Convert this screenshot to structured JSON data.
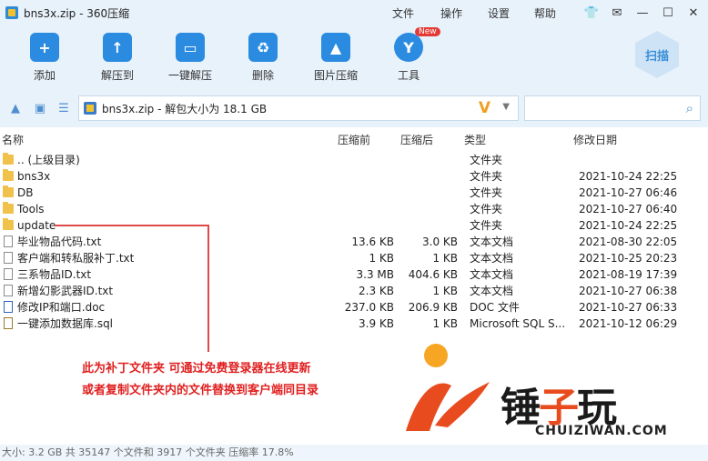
{
  "window": {
    "title": "bns3x.zip - 360压缩"
  },
  "menu": {
    "file": "文件",
    "operation": "操作",
    "settings": "设置",
    "help": "帮助"
  },
  "toolbar": {
    "add": "添加",
    "extract_to": "解压到",
    "one_click_extract": "一键解压",
    "delete": "删除",
    "image_compress": "图片压缩",
    "tools": "工具",
    "new_badge": "New",
    "scan": "扫描"
  },
  "address": {
    "path": "bns3x.zip - 解包大小为 18.1 GB",
    "search_value": ""
  },
  "columns": {
    "name": "名称",
    "compressed": "压缩前",
    "uncompressed": "压缩后",
    "type": "类型",
    "modified": "修改日期"
  },
  "rows": [
    {
      "name": ".. (上级目录)",
      "before": "",
      "after": "",
      "type": "文件夹",
      "date": "",
      "icon": "folder"
    },
    {
      "name": "bns3x",
      "before": "",
      "after": "",
      "type": "文件夹",
      "date": "2021-10-24 22:25",
      "icon": "folder"
    },
    {
      "name": "DB",
      "before": "",
      "after": "",
      "type": "文件夹",
      "date": "2021-10-27 06:46",
      "icon": "folder"
    },
    {
      "name": "Tools",
      "before": "",
      "after": "",
      "type": "文件夹",
      "date": "2021-10-27 06:40",
      "icon": "folder"
    },
    {
      "name": "update",
      "before": "",
      "after": "",
      "type": "文件夹",
      "date": "2021-10-24 22:25",
      "icon": "folder"
    },
    {
      "name": "毕业物品代码.txt",
      "before": "13.6 KB",
      "after": "3.0 KB",
      "type": "文本文档",
      "date": "2021-08-30 22:05",
      "icon": "file"
    },
    {
      "name": "客户端和转私服补丁.txt",
      "before": "1 KB",
      "after": "1 KB",
      "type": "文本文档",
      "date": "2021-10-25 20:23",
      "icon": "file"
    },
    {
      "name": "三系物品ID.txt",
      "before": "3.3 MB",
      "after": "404.6 KB",
      "type": "文本文档",
      "date": "2021-08-19 17:39",
      "icon": "file"
    },
    {
      "name": "新增幻影武器ID.txt",
      "before": "2.3 KB",
      "after": "1 KB",
      "type": "文本文档",
      "date": "2021-10-27 06:38",
      "icon": "file"
    },
    {
      "name": "修改IP和端口.doc",
      "before": "237.0 KB",
      "after": "206.9 KB",
      "type": "DOC 文件",
      "date": "2021-10-27 06:33",
      "icon": "doc"
    },
    {
      "name": "一键添加数据库.sql",
      "before": "3.9 KB",
      "after": "1 KB",
      "type": "Microsoft SQL S...",
      "date": "2021-10-12 06:29",
      "icon": "sql"
    }
  ],
  "annotation": {
    "line1": "此为补丁文件夹 可通过免费登录器在线更新",
    "line2": "或者复制文件夹内的文件替换到客户端同目录"
  },
  "watermark": {
    "brand_a": "锤",
    "brand_b": "子",
    "brand_c": "玩",
    "site": "CHUIZIWAN.COM"
  },
  "status": {
    "text": "大小: 3.2 GB 共 35147 个文件和 3917 个文件夹 压缩率 17.8%"
  },
  "colors": {
    "accent": "#2a8be0",
    "annotation": "#e02020",
    "folder": "#f1c24b",
    "chrome": "#e8f2fb"
  }
}
